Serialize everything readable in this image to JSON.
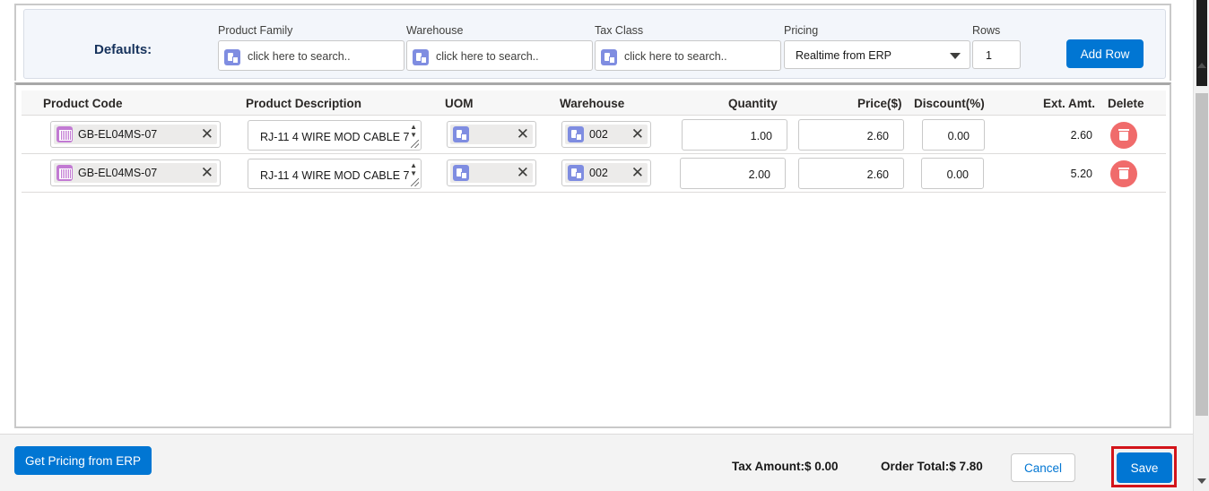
{
  "defaults": {
    "title": "Defaults:",
    "product_family": {
      "label": "Product Family",
      "placeholder": "click here to search.."
    },
    "warehouse": {
      "label": "Warehouse",
      "placeholder": "click here to search.."
    },
    "tax_class": {
      "label": "Tax Class",
      "placeholder": "click here to search.."
    },
    "pricing": {
      "label": "Pricing",
      "value": "Realtime from ERP"
    },
    "rows": {
      "label": "Rows",
      "value": "1"
    },
    "add_row_label": "Add Row"
  },
  "table": {
    "headers": {
      "product_code": "Product Code",
      "product_description": "Product Description",
      "uom": "UOM",
      "warehouse": "Warehouse",
      "quantity": "Quantity",
      "price": "Price($)",
      "discount": "Discount(%)",
      "ext_amt": "Ext. Amt.",
      "delete": "Delete"
    },
    "rows": [
      {
        "product_code": "GB-EL04MS-07",
        "description": "RJ-11 4 WIRE MOD CABLE 7",
        "uom": "",
        "warehouse": "002",
        "quantity": "1.00",
        "price": "2.60",
        "discount": "0.00",
        "ext_amt": "2.60"
      },
      {
        "product_code": "GB-EL04MS-07",
        "description": "RJ-11 4 WIRE MOD CABLE 7",
        "uom": "",
        "warehouse": "002",
        "quantity": "2.00",
        "price": "2.60",
        "discount": "0.00",
        "ext_amt": "5.20"
      }
    ]
  },
  "footer": {
    "get_pricing_label": "Get Pricing from ERP",
    "tax_amount": "Tax Amount:$ 0.00",
    "order_total": "Order Total:$ 7.80",
    "cancel_label": "Cancel",
    "save_label": "Save"
  },
  "colors": {
    "brand": "#0176d3",
    "delete": "#f06b6b",
    "highlight": "#d3141a",
    "defaults_title": "#16325c"
  }
}
